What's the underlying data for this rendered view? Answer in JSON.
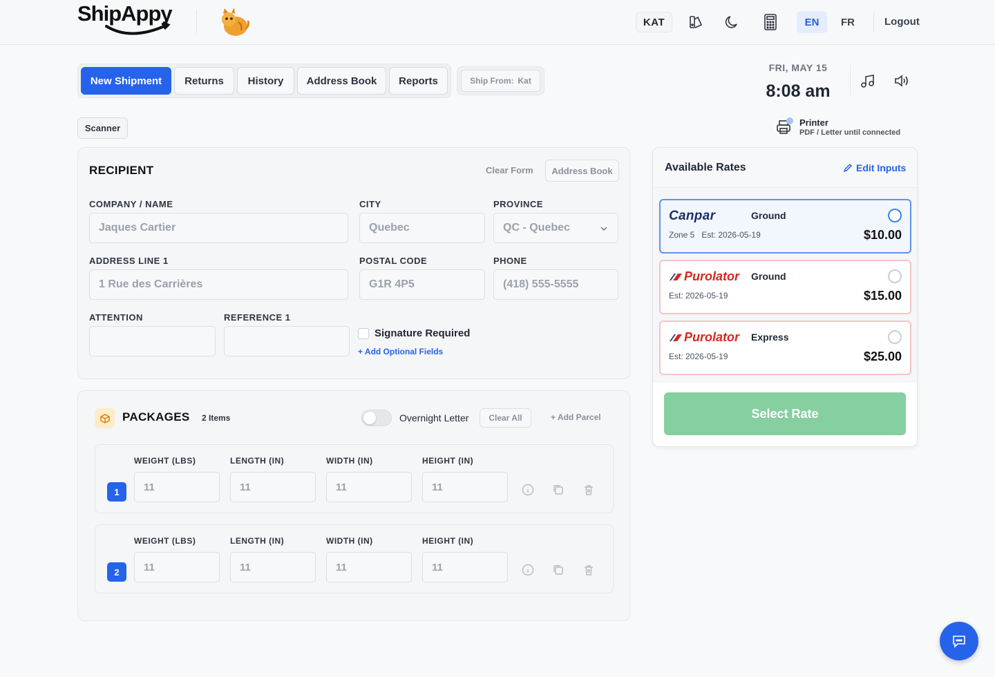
{
  "header": {
    "logo_text": "ShipAppy",
    "user_badge": "KAT",
    "lang_en": "EN",
    "lang_fr": "FR",
    "logout": "Logout"
  },
  "tabs": [
    {
      "label": "New Shipment",
      "active": true
    },
    {
      "label": "Returns"
    },
    {
      "label": "History"
    },
    {
      "label": "Address Book"
    },
    {
      "label": "Reports"
    }
  ],
  "ship_from": {
    "label": "Ship From:",
    "value": "Kat"
  },
  "clock": {
    "date": "FRI, MAY 15",
    "time": "8:08 am"
  },
  "printer": {
    "title": "Printer",
    "status": "PDF / Letter until connected"
  },
  "scanner_label": "Scanner",
  "recipient": {
    "title": "RECIPIENT",
    "clear_form": "Clear Form",
    "address_book": "Address Book",
    "fields": {
      "company": {
        "label": "COMPANY / NAME",
        "placeholder": "Jaques Cartier"
      },
      "city": {
        "label": "CITY",
        "placeholder": "Quebec"
      },
      "province": {
        "label": "PROVINCE",
        "value": "QC - Quebec"
      },
      "address1": {
        "label": "ADDRESS LINE 1",
        "placeholder": "1 Rue des Carrières"
      },
      "postal": {
        "label": "POSTAL CODE",
        "placeholder": "G1R 4P5"
      },
      "phone": {
        "label": "PHONE",
        "placeholder": "(418) 555-5555"
      },
      "attention": {
        "label": "ATTENTION",
        "placeholder": ""
      },
      "reference1": {
        "label": "REFERENCE 1",
        "placeholder": ""
      }
    },
    "signature_label": "Signature Required",
    "add_optional": "+ Add Optional Fields"
  },
  "packages": {
    "title": "PACKAGES",
    "count": "2 Items",
    "overnight_label": "Overnight Letter",
    "clear_all": "Clear All",
    "add_parcel": "Add Parcel",
    "labels": {
      "weight": "WEIGHT (LBS)",
      "length": "LENGTH (IN)",
      "width": "WIDTH (IN)",
      "height": "HEIGHT (IN)"
    },
    "rows": [
      {
        "num": "1",
        "weight": "11",
        "length": "11",
        "width": "11",
        "height": "11"
      },
      {
        "num": "2",
        "weight": "11",
        "length": "11",
        "width": "11",
        "height": "11"
      }
    ]
  },
  "rates": {
    "title": "Available Rates",
    "edit_inputs": "Edit Inputs",
    "options": [
      {
        "carrier": "Canpar",
        "service": "Ground",
        "zone": "Zone 5",
        "est": "Est: 2026-05-19",
        "price": "$10.00",
        "selected": true
      },
      {
        "carrier": "Purolator",
        "service": "Ground",
        "est": "Est: 2026-05-19",
        "price": "$15.00"
      },
      {
        "carrier": "Purolator",
        "service": "Express",
        "est": "Est: 2026-05-19",
        "price": "$25.00"
      }
    ],
    "select_button": "Select Rate"
  },
  "colors": {
    "primary": "#2563eb",
    "select_rate": "#86cfa0",
    "purolator_red": "#d5281f",
    "canpar_navy": "#1d2e6b"
  }
}
